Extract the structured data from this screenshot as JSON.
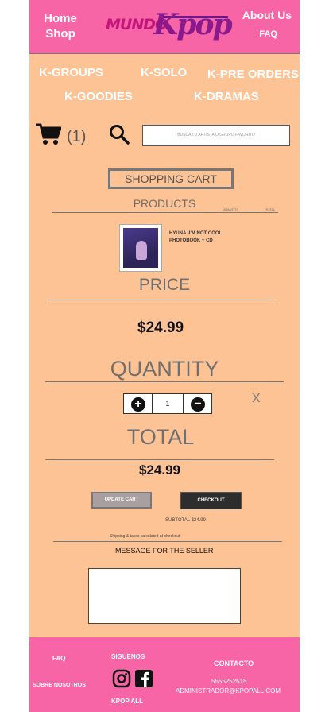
{
  "header": {
    "home_line1": "Home",
    "home_line2": "Shop",
    "logo_mundo": "MUNDO",
    "logo_kpop": "Kpop",
    "about": "About Us",
    "faq": "FAQ"
  },
  "nav": {
    "groups": "K-GROUPS",
    "solo": "K-SOLO",
    "preorders": "K-PRE ORDERS",
    "goodies": "K-GOODIES",
    "dramas": "K-DRAMAS"
  },
  "toolbar": {
    "cart_count": "(1)",
    "search_placeholder": "BUSCA TU ARTISTA O GRUPO FAVORITO"
  },
  "cart": {
    "title": "SHOPPING CART",
    "products_label": "PRODUCTS",
    "quantity_small": "QUANTITY",
    "total_small": "TOTAL",
    "product_name": "HYUNA -I'M NOT COOL PHOTOBOOK + CD",
    "price_label": "PRICE",
    "price_value": "$24.99",
    "quantity_label": "QUANTITY",
    "quantity_value": "1",
    "remove": "X",
    "total_label": "TOTAL",
    "total_value": "$24.99",
    "update_button": "UPDATE CART",
    "checkout_button": "CHECKOUT",
    "subtotal": "SUBTOTAL $24.99",
    "shipping_note": "Shipping & taxes calculated at checkout",
    "message_label": "MESSAGE FOR THE SELLER"
  },
  "footer": {
    "faq": "FAQ",
    "about": "SOBRE NOSOTROS",
    "follow": "SIGUENOS",
    "brand": "KPOP ALL",
    "contact_title": "CONTACTO",
    "phone": "5555252515",
    "email": "ADMINISTRADOR@KPOPALL.COM"
  },
  "colors": {
    "header_pink": "#f765a6",
    "body_peach": "#fec395",
    "logo_magenta": "#c4167a",
    "logo_purple": "#8a1a8c"
  }
}
